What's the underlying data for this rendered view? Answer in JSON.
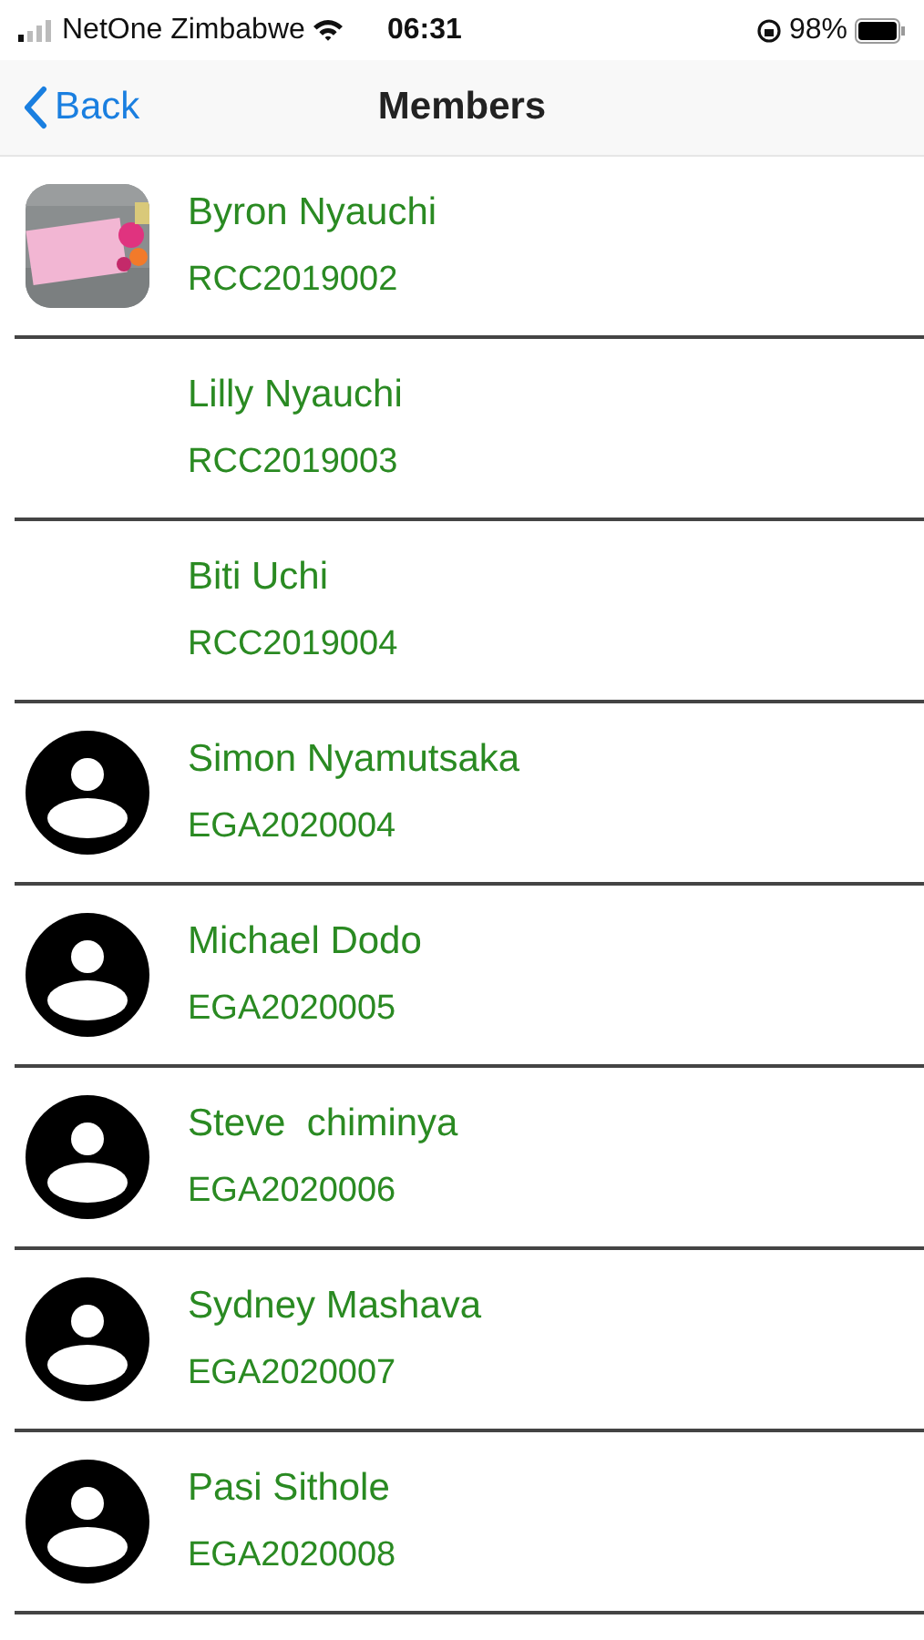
{
  "status_bar": {
    "carrier": "NetOne Zimbabwe",
    "time": "06:31",
    "battery": "98%"
  },
  "nav": {
    "back": "Back",
    "title": "Members"
  },
  "members": [
    {
      "kind": "picture",
      "name": "Byron Nyauchi",
      "code": "RCC2019002"
    },
    {
      "kind": "blank",
      "name": "Lilly Nyauchi",
      "code": "RCC2019003"
    },
    {
      "kind": "blank",
      "name": "Biti Uchi",
      "code": "RCC2019004"
    },
    {
      "kind": "placeholder",
      "name": "Simon Nyamutsaka",
      "code": "EGA2020004"
    },
    {
      "kind": "placeholder",
      "name": "Michael Dodo",
      "code": "EGA2020005"
    },
    {
      "kind": "placeholder",
      "name": "Steve  chiminya",
      "code": "EGA2020006"
    },
    {
      "kind": "placeholder",
      "name": "Sydney Mashava",
      "code": "EGA2020007"
    },
    {
      "kind": "placeholder",
      "name": "Pasi Sithole",
      "code": "EGA2020008"
    }
  ]
}
